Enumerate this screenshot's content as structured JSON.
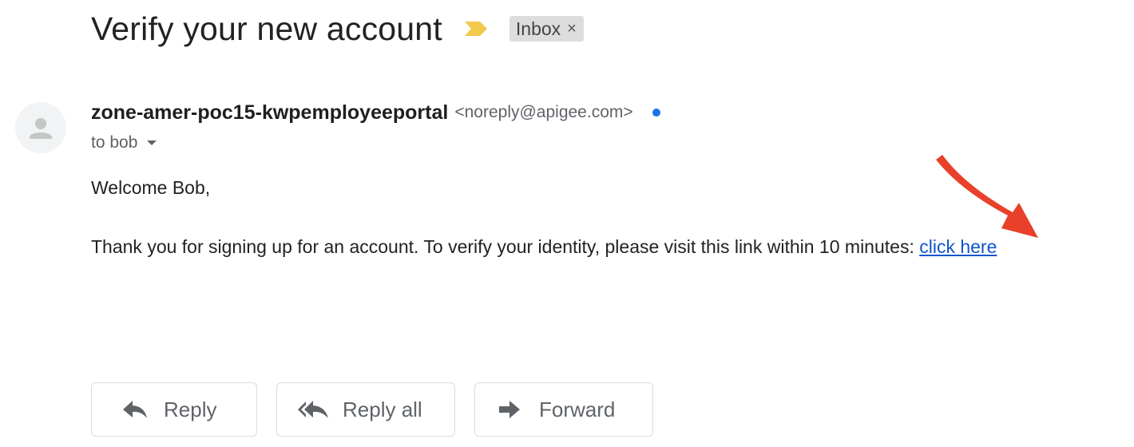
{
  "email": {
    "subject": "Verify your new account",
    "label": {
      "text": "Inbox",
      "close": "×"
    },
    "sender": {
      "name": "zone-amer-poc15-kwpemployeeportal",
      "email": "<noreply@apigee.com>"
    },
    "recipient": "to bob",
    "greeting": "Welcome Bob,",
    "message": "Thank you for signing up for an account. To verify your identity, please visit this link within 10 minutes: ",
    "link_text": "click here"
  },
  "actions": {
    "reply_label": "Reply",
    "reply_all_label": "Reply all",
    "forward_label": "Forward"
  },
  "icons": {
    "importance": "importance-marker-icon",
    "avatar": "person-avatar-icon",
    "unread": "unread-dot",
    "reply": "reply-icon",
    "reply_all": "reply-all-icon",
    "forward": "forward-icon",
    "annotation": "red-arrow-annotation"
  },
  "colors": {
    "importance_marker": "#f2c94c",
    "unread_dot": "#1a73e8",
    "link": "#1155cc",
    "annotation_arrow": "#e8402a",
    "label_chip_bg": "#dddddd"
  }
}
